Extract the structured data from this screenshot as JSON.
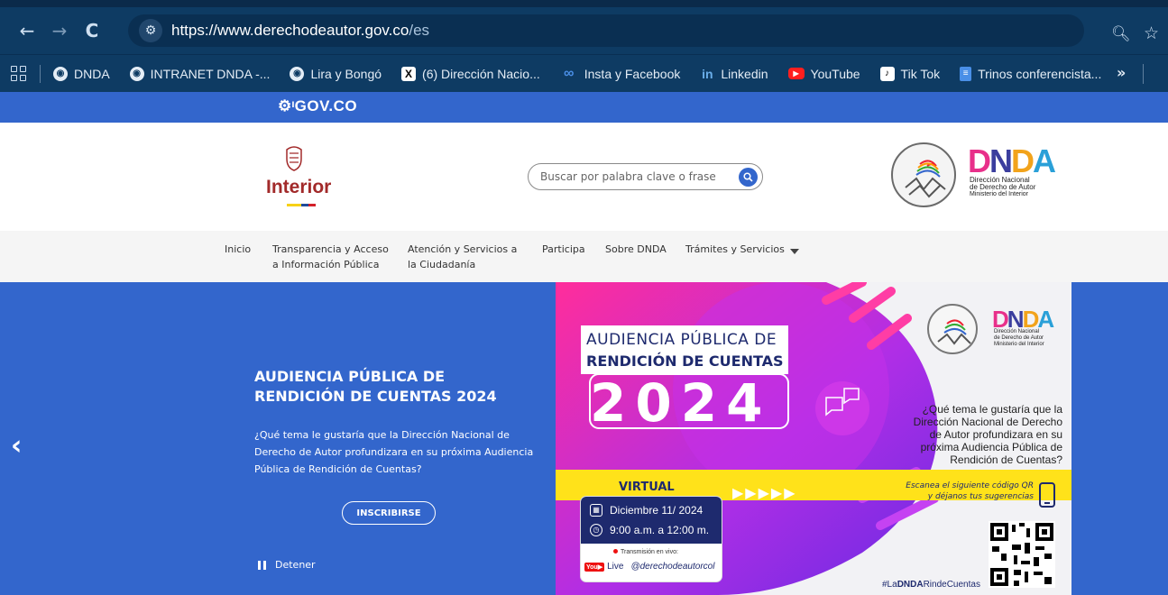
{
  "browser": {
    "url_host": "https://www.derechodeautor.gov.co",
    "url_path": "/es",
    "bookmarks": [
      {
        "label": "DNDA",
        "icon": "globe-icon"
      },
      {
        "label": "INTRANET DNDA -...",
        "icon": "globe-icon"
      },
      {
        "label": "Lira y Bongó",
        "icon": "globe-icon"
      },
      {
        "label": "(6) Dirección Nacio...",
        "icon": "x-icon"
      },
      {
        "label": "Insta y Facebook",
        "icon": "meta-icon"
      },
      {
        "label": "Linkedin",
        "icon": "linkedin-icon"
      },
      {
        "label": "YouTube",
        "icon": "youtube-icon"
      },
      {
        "label": "Tik Tok",
        "icon": "tiktok-icon"
      },
      {
        "label": "Trinos conferencista...",
        "icon": "docs-icon"
      }
    ],
    "more_label": "»"
  },
  "gov": {
    "logo_text": "GOV.CO"
  },
  "header": {
    "ministry": "Interior",
    "search_placeholder": "Buscar por palabra clave o frase",
    "dnda_word": "DNDA",
    "dnda_lines": [
      "Dirección Nacional",
      "de Derecho de Autor",
      "Ministerio del Interior"
    ]
  },
  "nav": {
    "items": [
      {
        "line1": "Inicio",
        "line2": ""
      },
      {
        "line1": "Transparencia y Acceso",
        "line2": "a Información Pública"
      },
      {
        "line1": "Atención y Servicios a",
        "line2": "la Ciudadanía"
      },
      {
        "line1": "Participa",
        "line2": ""
      },
      {
        "line1": "Sobre DNDA",
        "line2": ""
      },
      {
        "line1": "Trámites y Servicios",
        "line2": ""
      }
    ]
  },
  "hero": {
    "title_line1": "AUDIENCIA PÚBLICA DE",
    "title_line2": "RENDICIÓN DE CUENTAS 2024",
    "text": "¿Qué tema le gustaría que la Dirección Nacional de Derecho de Autor profundizara en su próxima Audiencia Pública de Rendición de Cuentas?",
    "button": "INSCRIBIRSE",
    "pause_label": "Detener"
  },
  "banner": {
    "title1": "AUDIENCIA PÚBLICA DE",
    "title2": "RENDICIÓN DE CUENTAS",
    "year": "2024",
    "question": "¿Qué tema le gustaría que la Dirección Nacional de Derecho de Autor profundizara en su próxima Audiencia Pública de Rendición de Cuentas?",
    "virtual": "VIRTUAL",
    "scan_line1": "Escanea el siguiente código QR",
    "scan_line2": "y déjanos tus sugerencias",
    "date": "Diciembre  11/ 2024",
    "time": "9:00 a.m. a 12:00 m.",
    "live_label": "Transmisión en vivo:",
    "live_word": "Live",
    "handle": "@derechodeautorcol",
    "hashtag_pre": "#La",
    "hashtag_bold": "DNDA",
    "hashtag_post": "RindeCuentas",
    "dnda_word": "DNDA",
    "dnda_lines": [
      "Dirección Nacional",
      "de Derecho de Autor",
      "Ministerio del Interior"
    ]
  },
  "colors": {
    "gov_blue": "#3366cc",
    "chrome": "#0e3b63",
    "dnda_navy": "#1e2a6e",
    "magenta": "#ff2d9b",
    "purple": "#8b2be2",
    "yellow": "#ffe21a"
  }
}
